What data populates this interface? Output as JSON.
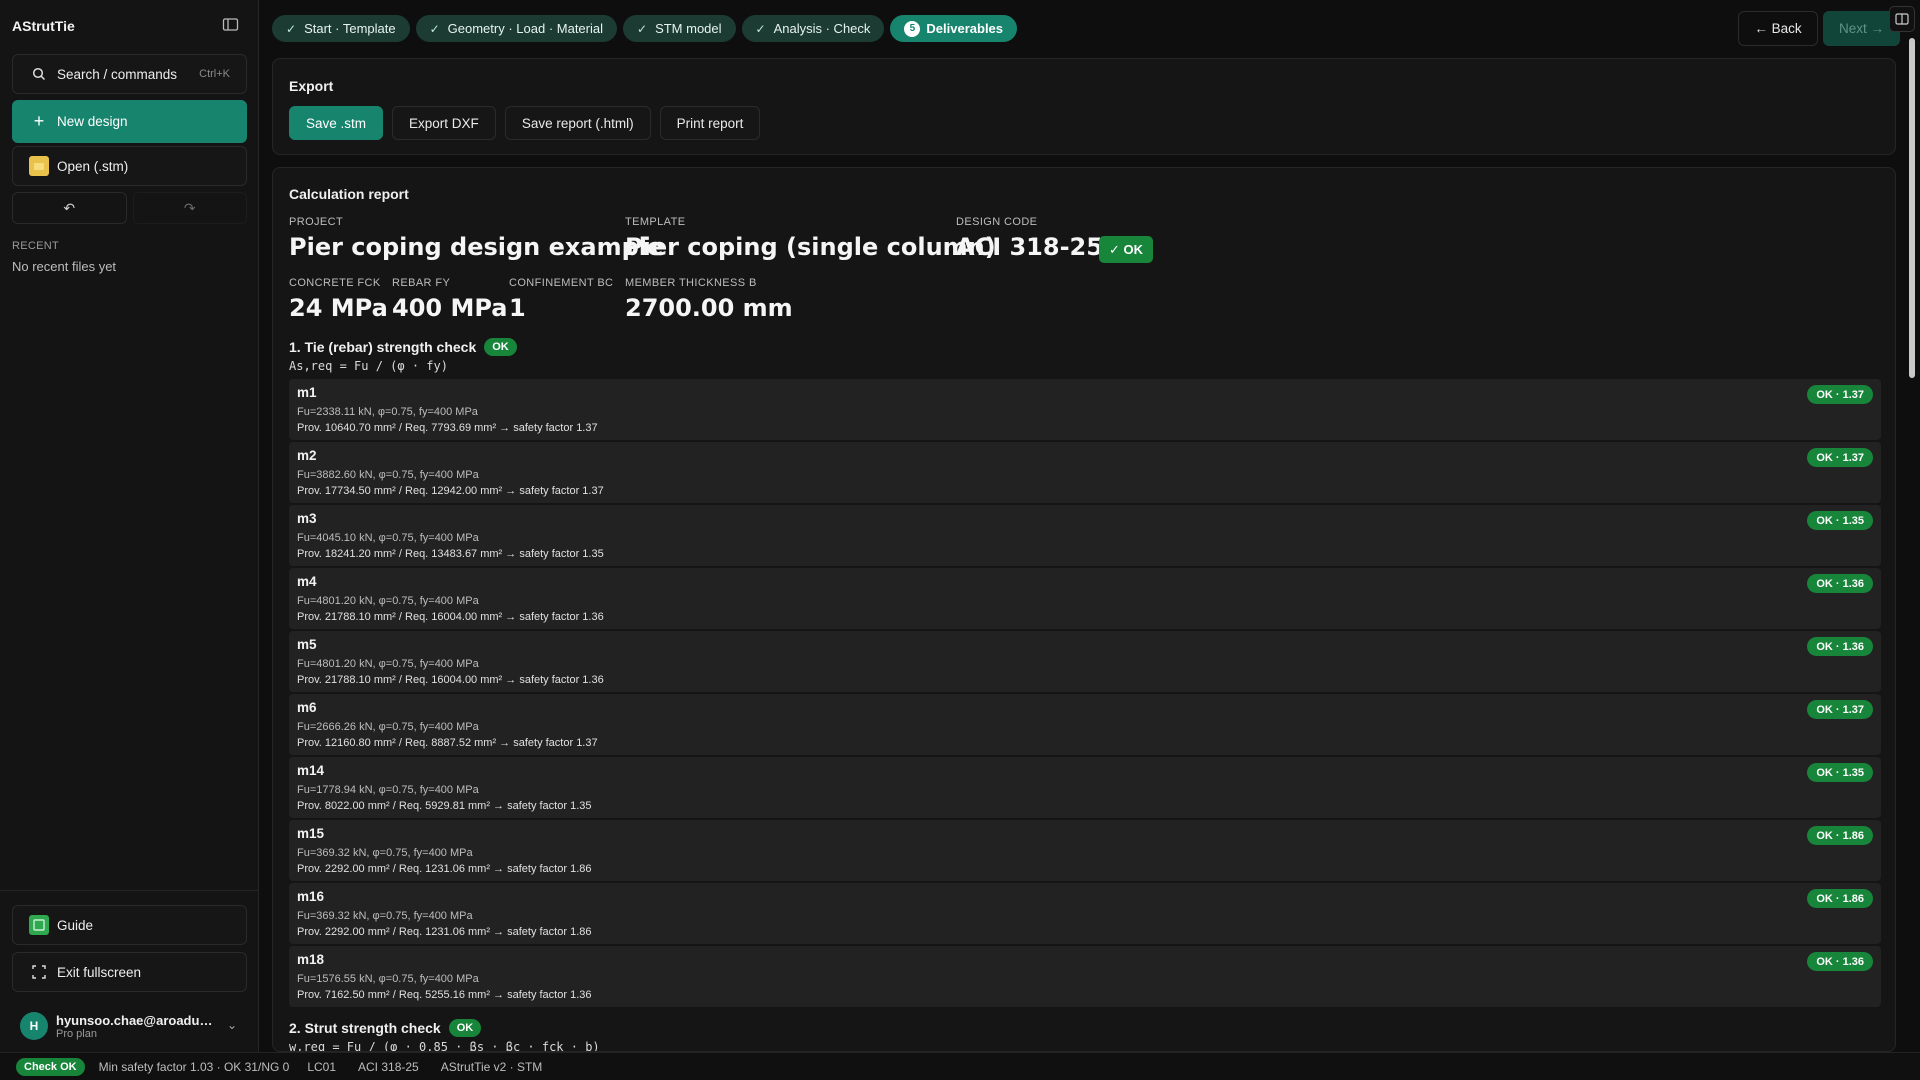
{
  "app": {
    "title": "AStrutTie"
  },
  "sidebar": {
    "search_label": "Search / commands",
    "search_shortcut": "Ctrl+K",
    "new_design": "New design",
    "open": "Open (.stm)",
    "recent_label": "RECENT",
    "recent_empty": "No recent files yet",
    "guide": "Guide",
    "exit_fullscreen": "Exit fullscreen",
    "user": {
      "initial": "H",
      "email": "hyunsoo.chae@aroadus…",
      "plan": "Pro plan"
    }
  },
  "steps": [
    {
      "label": "Start · Template",
      "done": true
    },
    {
      "label": "Geometry · Load · Material",
      "done": true
    },
    {
      "label": "STM model",
      "done": true
    },
    {
      "label": "Analysis · Check",
      "done": true
    },
    {
      "label": "Deliverables",
      "number": "5",
      "active": true
    }
  ],
  "nav": {
    "back": "← Back",
    "next": "Next →"
  },
  "export": {
    "title": "Export",
    "buttons": [
      "Save .stm",
      "Export DXF",
      "Save report (.html)",
      "Print report"
    ]
  },
  "report": {
    "title": "Calculation report",
    "project_label": "PROJECT",
    "project": "Pier coping design example",
    "template_label": "TEMPLATE",
    "template": "Pier coping (single column)",
    "code_label": "DESIGN CODE",
    "code": "ACI 318-25",
    "code_status": "✓ OK",
    "fck_label": "CONCRETE FCK",
    "fck": "24 MPa",
    "fy_label": "REBAR FY",
    "fy": "400 MPa",
    "bc_label": "CONFINEMENT BC",
    "bc": "1",
    "thick_label": "MEMBER THICKNESS B",
    "thick": "2700.00 mm",
    "section1": {
      "title": "1. Tie (rebar) strength check",
      "status": "OK",
      "formula": "As,req = Fu / (φ · fy)"
    },
    "members": [
      {
        "name": "m1",
        "line1": "Fu=2338.11 kN, φ=0.75, fy=400 MPa",
        "line2": "Prov. 10640.70 mm² / Req. 7793.69 mm² → safety factor 1.37",
        "badge": "OK · 1.37"
      },
      {
        "name": "m2",
        "line1": "Fu=3882.60 kN, φ=0.75, fy=400 MPa",
        "line2": "Prov. 17734.50 mm² / Req. 12942.00 mm² → safety factor 1.37",
        "badge": "OK · 1.37"
      },
      {
        "name": "m3",
        "line1": "Fu=4045.10 kN, φ=0.75, fy=400 MPa",
        "line2": "Prov. 18241.20 mm² / Req. 13483.67 mm² → safety factor 1.35",
        "badge": "OK · 1.35"
      },
      {
        "name": "m4",
        "line1": "Fu=4801.20 kN, φ=0.75, fy=400 MPa",
        "line2": "Prov. 21788.10 mm² / Req. 16004.00 mm² → safety factor 1.36",
        "badge": "OK · 1.36"
      },
      {
        "name": "m5",
        "line1": "Fu=4801.20 kN, φ=0.75, fy=400 MPa",
        "line2": "Prov. 21788.10 mm² / Req. 16004.00 mm² → safety factor 1.36",
        "badge": "OK · 1.36"
      },
      {
        "name": "m6",
        "line1": "Fu=2666.26 kN, φ=0.75, fy=400 MPa",
        "line2": "Prov. 12160.80 mm² / Req. 8887.52 mm² → safety factor 1.37",
        "badge": "OK · 1.37"
      },
      {
        "name": "m14",
        "line1": "Fu=1778.94 kN, φ=0.75, fy=400 MPa",
        "line2": "Prov. 8022.00 mm² / Req. 5929.81 mm² → safety factor 1.35",
        "badge": "OK · 1.35"
      },
      {
        "name": "m15",
        "line1": "Fu=369.32 kN, φ=0.75, fy=400 MPa",
        "line2": "Prov. 2292.00 mm² / Req. 1231.06 mm² → safety factor 1.86",
        "badge": "OK · 1.86"
      },
      {
        "name": "m16",
        "line1": "Fu=369.32 kN, φ=0.75, fy=400 MPa",
        "line2": "Prov. 2292.00 mm² / Req. 1231.06 mm² → safety factor 1.86",
        "badge": "OK · 1.86"
      },
      {
        "name": "m18",
        "line1": "Fu=1576.55 kN, φ=0.75, fy=400 MPa",
        "line2": "Prov. 7162.50 mm² / Req. 5255.16 mm² → safety factor 1.36",
        "badge": "OK · 1.36"
      }
    ],
    "section2": {
      "title": "2. Strut strength check",
      "status": "OK",
      "formula": "w,req = Fu / (φ · 0.85 · βs · βc · fck · b)"
    }
  },
  "statusbar": {
    "check": "Check OK",
    "summary": "Min safety factor 1.03 · OK 31/NG 0",
    "loadcase": "LC01",
    "code": "ACI 318-25",
    "version": "AStrutTie v2 · STM"
  },
  "colors": {
    "accent": "#17856e",
    "ok": "#17853a",
    "bg": "#0e0e0e"
  }
}
